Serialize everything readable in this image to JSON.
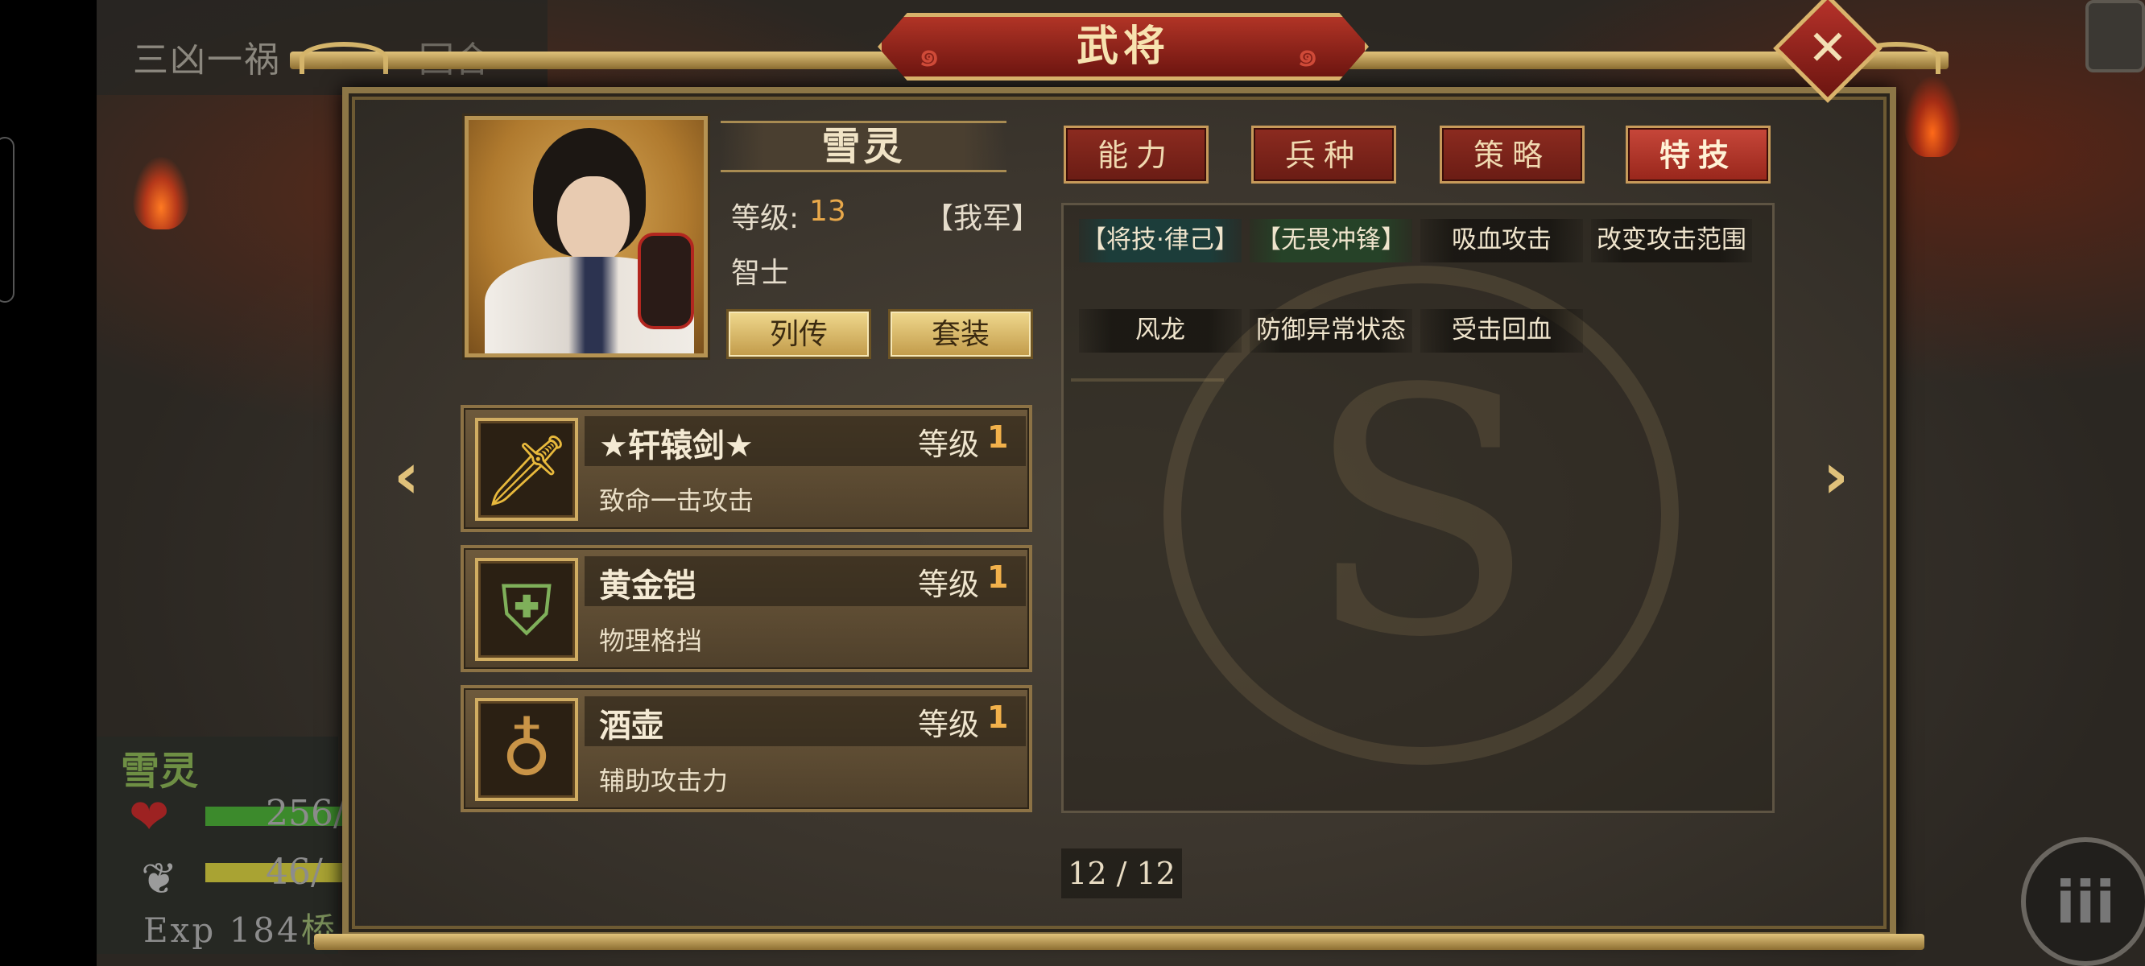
{
  "background": {
    "stage_title": "三凶一祸",
    "round_label": "回合",
    "hero_name": "雪灵",
    "hp_text": "256/",
    "mp_text": "46/",
    "exp_text": "Exp 184",
    "exp_suffix": "桥",
    "menu_glyph": "iii"
  },
  "window": {
    "title": "武将",
    "close_glyph": "✕"
  },
  "hero": {
    "name": "雪灵",
    "level_label": "等级:",
    "level_value": "13",
    "faction": "【我军】",
    "class": "智士",
    "buttons": {
      "biography": "列传",
      "equip_set": "套装"
    }
  },
  "equipment": [
    {
      "name": "★轩辕剑★",
      "level_label": "等级",
      "level": "1",
      "desc": "致命一击攻击",
      "icon": "sword-icon"
    },
    {
      "name": "黄金铠",
      "level_label": "等级",
      "level": "1",
      "desc": "物理格挡",
      "icon": "armor-icon"
    },
    {
      "name": "酒壶",
      "level_label": "等级",
      "level": "1",
      "desc": "辅助攻击力",
      "icon": "gourd-icon"
    }
  ],
  "tabs": [
    {
      "label": "能力",
      "active": false
    },
    {
      "label": "兵种",
      "active": false
    },
    {
      "label": "策略",
      "active": false
    },
    {
      "label": "特技",
      "active": true
    }
  ],
  "skills": [
    {
      "label": "【将技·律己】",
      "style": "teal"
    },
    {
      "label": "【无畏冲锋】",
      "style": "green"
    },
    {
      "label": "吸血攻击",
      "style": "dark"
    },
    {
      "label": "改变攻击范围",
      "style": "dark"
    },
    {
      "label": "风龙",
      "style": "dark"
    },
    {
      "label": "防御异常状态",
      "style": "dark"
    },
    {
      "label": "受击回血",
      "style": "dark"
    }
  ],
  "pagination": {
    "text": "12 / 12"
  },
  "colors": {
    "gold": "#e0c17a",
    "tab_red": "#8c2b20",
    "tab_active_red": "#c7473a",
    "level_orange": "#f2b14b"
  }
}
